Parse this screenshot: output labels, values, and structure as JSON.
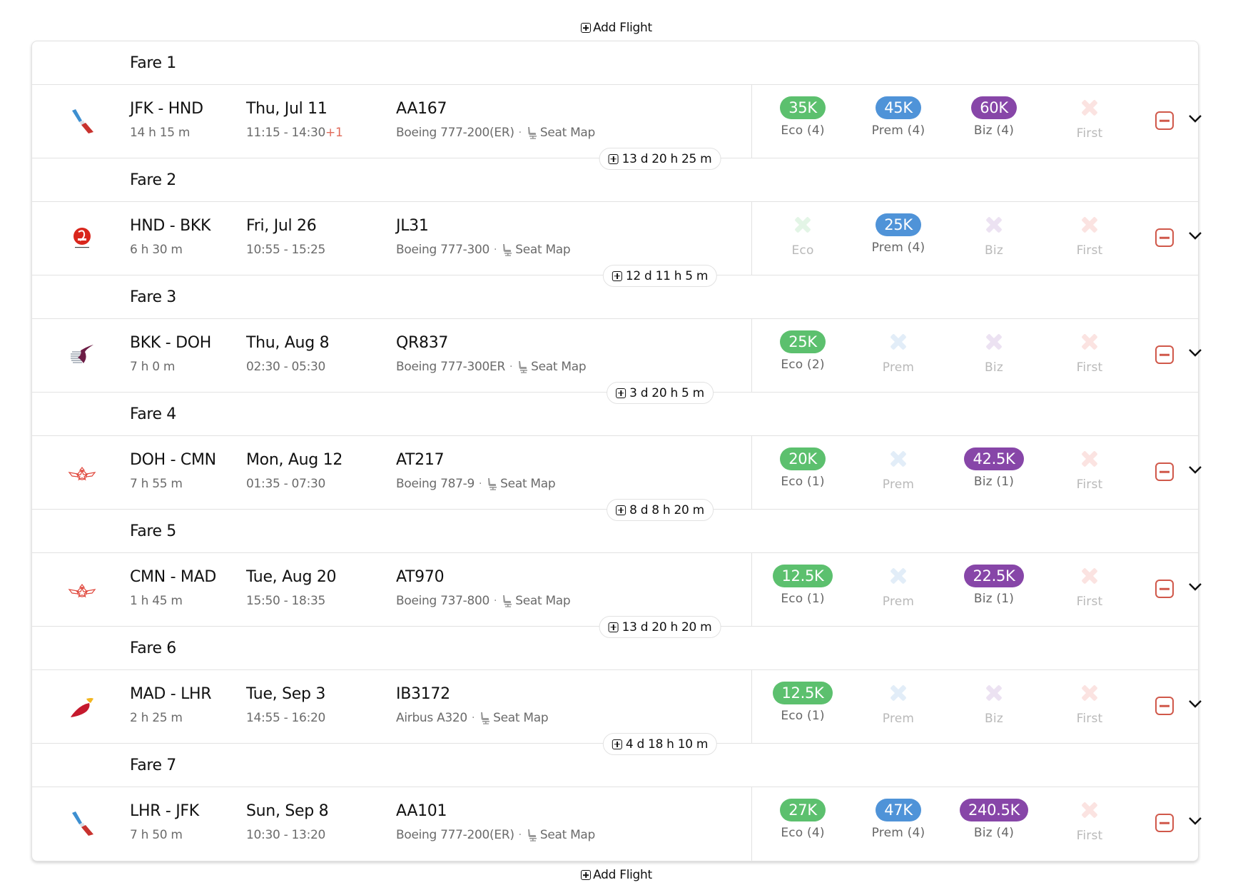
{
  "add_flight_label": "Add Flight",
  "seat_map_label": "Seat Map",
  "colors": {
    "eco": "#5cc06e",
    "prem": "#4f93d8",
    "biz": "#8746a8",
    "remove": "#d0584a",
    "next_day": "#e06a5a"
  },
  "fares": [
    {
      "title": "Fare 1",
      "airline_logo": "american-airlines-logo",
      "route": "JFK - HND",
      "duration": "14 h 15 m",
      "date": "Thu, Jul 11",
      "times": "11:15 - 14:30",
      "next_day": "+1",
      "flight_no": "AA167",
      "aircraft": "Boeing 777-200(ER)",
      "cabins": {
        "eco": {
          "available": true,
          "price": "35K",
          "label": "Eco (4)"
        },
        "prem": {
          "available": true,
          "price": "45K",
          "label": "Prem (4)"
        },
        "biz": {
          "available": true,
          "price": "60K",
          "label": "Biz (4)"
        },
        "first": {
          "available": false,
          "price": "",
          "label": "First"
        }
      },
      "layover": "13 d 20 h 25 m"
    },
    {
      "title": "Fare 2",
      "airline_logo": "japan-airlines-logo",
      "route": "HND - BKK",
      "duration": "6 h 30 m",
      "date": "Fri, Jul 26",
      "times": "10:55 - 15:25",
      "next_day": "",
      "flight_no": "JL31",
      "aircraft": "Boeing 777-300",
      "cabins": {
        "eco": {
          "available": false,
          "price": "",
          "label": "Eco"
        },
        "prem": {
          "available": true,
          "price": "25K",
          "label": "Prem (4)"
        },
        "biz": {
          "available": false,
          "price": "",
          "label": "Biz"
        },
        "first": {
          "available": false,
          "price": "",
          "label": "First"
        }
      },
      "layover": "12 d 11 h 5 m"
    },
    {
      "title": "Fare 3",
      "airline_logo": "qatar-airways-logo",
      "route": "BKK - DOH",
      "duration": "7 h 0 m",
      "date": "Thu, Aug 8",
      "times": "02:30 - 05:30",
      "next_day": "",
      "flight_no": "QR837",
      "aircraft": "Boeing 777-300ER",
      "cabins": {
        "eco": {
          "available": true,
          "price": "25K",
          "label": "Eco (2)"
        },
        "prem": {
          "available": false,
          "price": "",
          "label": "Prem"
        },
        "biz": {
          "available": false,
          "price": "",
          "label": "Biz"
        },
        "first": {
          "available": false,
          "price": "",
          "label": "First"
        }
      },
      "layover": "3 d 20 h 5 m"
    },
    {
      "title": "Fare 4",
      "airline_logo": "royal-air-maroc-logo",
      "route": "DOH - CMN",
      "duration": "7 h 55 m",
      "date": "Mon, Aug 12",
      "times": "01:35 - 07:30",
      "next_day": "",
      "flight_no": "AT217",
      "aircraft": "Boeing 787-9",
      "cabins": {
        "eco": {
          "available": true,
          "price": "20K",
          "label": "Eco (1)"
        },
        "prem": {
          "available": false,
          "price": "",
          "label": "Prem"
        },
        "biz": {
          "available": true,
          "price": "42.5K",
          "label": "Biz (1)"
        },
        "first": {
          "available": false,
          "price": "",
          "label": "First"
        }
      },
      "layover": "8 d 8 h 20 m"
    },
    {
      "title": "Fare 5",
      "airline_logo": "royal-air-maroc-logo",
      "route": "CMN - MAD",
      "duration": "1 h 45 m",
      "date": "Tue, Aug 20",
      "times": "15:50 - 18:35",
      "next_day": "",
      "flight_no": "AT970",
      "aircraft": "Boeing 737-800",
      "cabins": {
        "eco": {
          "available": true,
          "price": "12.5K",
          "label": "Eco (1)"
        },
        "prem": {
          "available": false,
          "price": "",
          "label": "Prem"
        },
        "biz": {
          "available": true,
          "price": "22.5K",
          "label": "Biz (1)"
        },
        "first": {
          "available": false,
          "price": "",
          "label": "First"
        }
      },
      "layover": "13 d 20 h 20 m"
    },
    {
      "title": "Fare 6",
      "airline_logo": "iberia-logo",
      "route": "MAD - LHR",
      "duration": "2 h 25 m",
      "date": "Tue, Sep 3",
      "times": "14:55 - 16:20",
      "next_day": "",
      "flight_no": "IB3172",
      "aircraft": "Airbus A320",
      "cabins": {
        "eco": {
          "available": true,
          "price": "12.5K",
          "label": "Eco (1)"
        },
        "prem": {
          "available": false,
          "price": "",
          "label": "Prem"
        },
        "biz": {
          "available": false,
          "price": "",
          "label": "Biz"
        },
        "first": {
          "available": false,
          "price": "",
          "label": "First"
        }
      },
      "layover": "4 d 18 h 10 m"
    },
    {
      "title": "Fare 7",
      "airline_logo": "american-airlines-logo",
      "route": "LHR - JFK",
      "duration": "7 h 50 m",
      "date": "Sun, Sep 8",
      "times": "10:30 - 13:20",
      "next_day": "",
      "flight_no": "AA101",
      "aircraft": "Boeing 777-200(ER)",
      "cabins": {
        "eco": {
          "available": true,
          "price": "27K",
          "label": "Eco (4)"
        },
        "prem": {
          "available": true,
          "price": "47K",
          "label": "Prem (4)"
        },
        "biz": {
          "available": true,
          "price": "240.5K",
          "label": "Biz (4)"
        },
        "first": {
          "available": false,
          "price": "",
          "label": "First"
        }
      },
      "layover": ""
    }
  ]
}
